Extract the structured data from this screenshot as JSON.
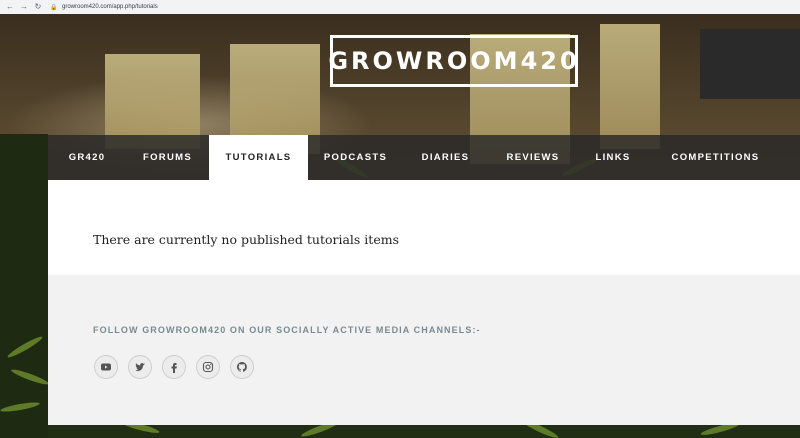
{
  "browser": {
    "url": "growroom420.com/app.php/tutorials",
    "back_icon": "arrow-left-icon",
    "forward_icon": "arrow-right-icon",
    "reload_icon": "reload-icon",
    "lock_icon": "lock-icon"
  },
  "site": {
    "logo_text": "GROWROOM420"
  },
  "nav": {
    "items": [
      {
        "label": "GR420",
        "active": false
      },
      {
        "label": "FORUMS",
        "active": false
      },
      {
        "label": "TUTORIALS",
        "active": true
      },
      {
        "label": "PODCASTS",
        "active": false
      },
      {
        "label": "DIARIES",
        "active": false
      },
      {
        "label": "REVIEWS",
        "active": false
      },
      {
        "label": "LINKS",
        "active": false
      },
      {
        "label": "COMPETITIONS",
        "active": false
      }
    ]
  },
  "main": {
    "message": "There are currently no published tutorials items"
  },
  "footer": {
    "follow_text": "FOLLOW GROWROOM420 ON OUR SOCIALLY ACTIVE MEDIA CHANNELS:-",
    "social_icons": [
      "youtube-icon",
      "twitter-icon",
      "facebook-icon",
      "instagram-icon",
      "github-icon"
    ]
  },
  "colors": {
    "nav_bg": "#282828",
    "nav_active_bg": "#ffffff",
    "footer_bg": "#f2f2f2",
    "follow_text": "#7a8a93"
  }
}
